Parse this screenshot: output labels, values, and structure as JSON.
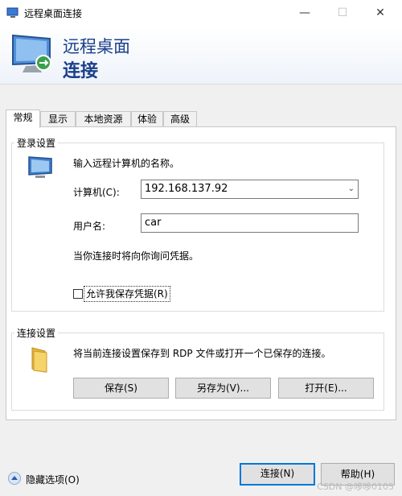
{
  "window": {
    "title": "远程桌面连接",
    "controls": {
      "minimize": "—",
      "maximize": "☐",
      "close": "✕"
    }
  },
  "banner": {
    "line1": "远程桌面",
    "line2": "连接"
  },
  "tabs": [
    {
      "label": "常规",
      "active": true
    },
    {
      "label": "显示"
    },
    {
      "label": "本地资源"
    },
    {
      "label": "体验"
    },
    {
      "label": "高级"
    }
  ],
  "login": {
    "legend": "登录设置",
    "instruction": "输入远程计算机的名称。",
    "computer_label": "计算机(C):",
    "computer_value": "192.168.137.92",
    "user_label": "用户名:",
    "user_value": "car",
    "prompt_note": "当你连接时将向你询问凭据。",
    "save_credentials_label": "允许我保存凭据(R)",
    "save_credentials_checked": false
  },
  "connection": {
    "legend": "连接设置",
    "description": "将当前连接设置保存到 RDP 文件或打开一个已保存的连接。",
    "save_label": "保存(S)",
    "save_as_label": "另存为(V)...",
    "open_label": "打开(E)..."
  },
  "footer": {
    "hide_options_label": "隐藏选项(O)",
    "connect_label": "连接(N)",
    "help_label": "帮助(H)",
    "watermark": "CSDN @哆哆0105"
  },
  "colors": {
    "accent": "#0078d7",
    "banner_text": "#1b3f8a"
  }
}
